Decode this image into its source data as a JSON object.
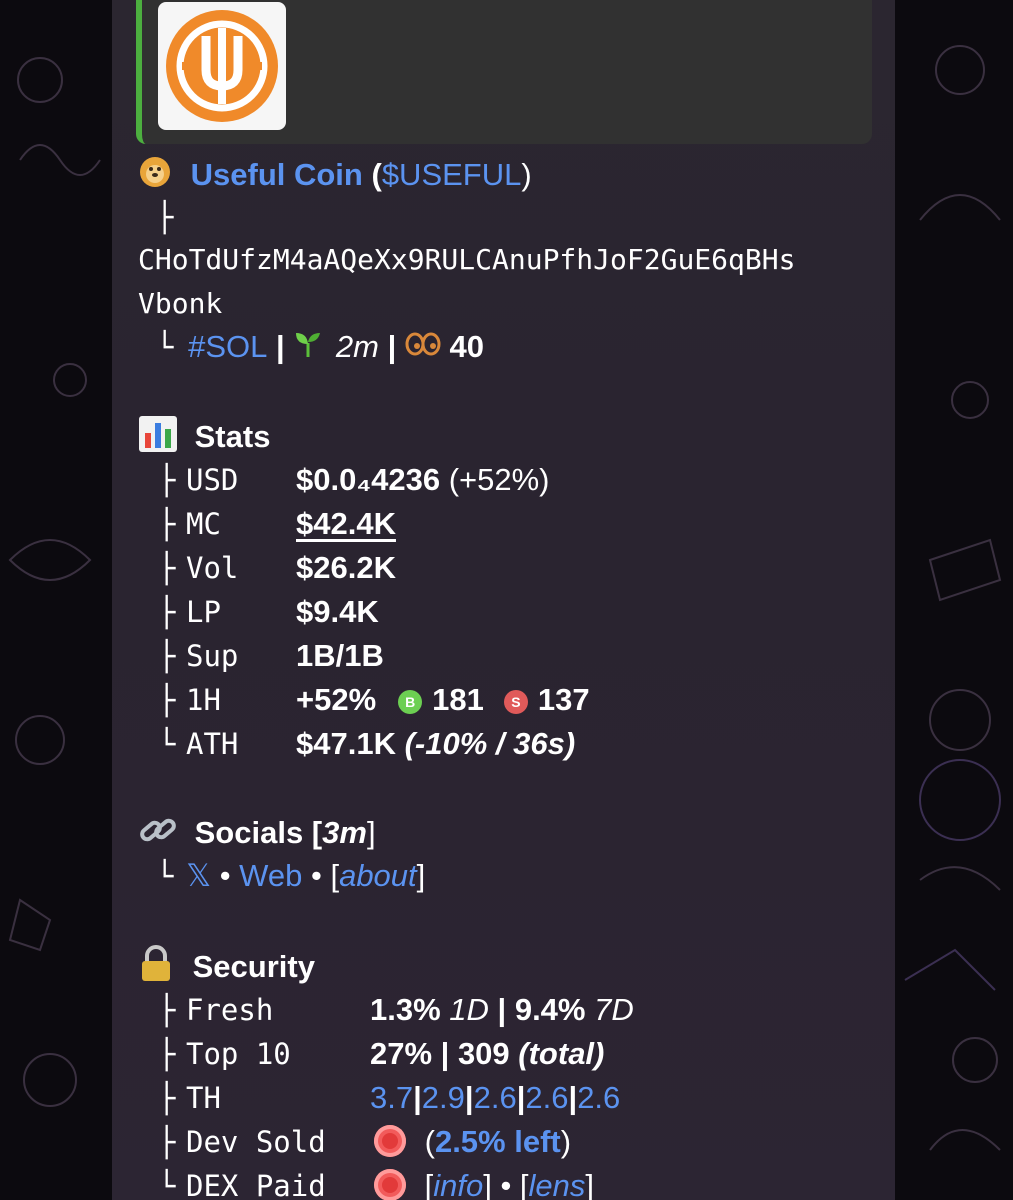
{
  "token": {
    "name": "Useful Coin",
    "ticker_open": "(",
    "ticker": "$USEFUL",
    "ticker_close": ")",
    "address_line1": "CHoTdUfzM4aAQeXx9RULCAnuPfhJoF2GuE6qBHs",
    "address_line2": "Vbonk",
    "chain": "#SOL",
    "age": "2m",
    "holders_count": "40"
  },
  "stats": {
    "heading": "Stats",
    "rows": [
      {
        "label": "USD",
        "value": "$0.0₄4236",
        "extra": " (+52%)"
      },
      {
        "label": "MC",
        "value": "$42.4K"
      },
      {
        "label": "Vol",
        "value": "$26.2K"
      },
      {
        "label": "LP",
        "value": "$9.4K"
      },
      {
        "label": "Sup",
        "value": "1B/1B"
      },
      {
        "label": "1H",
        "value": "+52%",
        "buys": "181",
        "sells": "137"
      },
      {
        "label": "ATH",
        "value": "$47.1K",
        "extra": " (-10% / 36s)"
      }
    ]
  },
  "socials": {
    "heading": "Socials [",
    "age": "3m",
    "heading_close": "]",
    "x": "𝕏",
    "sep": " • ",
    "web": "Web",
    "about_open": "[",
    "about": "about",
    "about_close": "]"
  },
  "security": {
    "heading": "Security",
    "fresh_label": "Fresh",
    "fresh_1d": "1.3%",
    "fresh_1d_unit": " 1D",
    "fresh_sep": " | ",
    "fresh_7d": "9.4%",
    "fresh_7d_unit": " 7D",
    "top10_label": "Top 10",
    "top10_value": "27% | 309",
    "top10_extra": " (total)",
    "th_label": "TH",
    "th_values": [
      "3.7",
      "2.9",
      "2.6",
      "2.6",
      "2.6"
    ],
    "dev_label": "Dev Sold",
    "dev_open": "(",
    "dev_value": "2.5% left",
    "dev_close": ")",
    "dex_label": "DEX Paid",
    "dex_open": "[",
    "dex_info": "info",
    "dex_mid": "] • [",
    "dex_lens": "lens",
    "dex_close": "]"
  },
  "glyphs": {
    "tee": "├",
    "corner": "└",
    "pipe": " | "
  },
  "colors": {
    "link": "#5b93f0",
    "preview_bar": "#4caf3f",
    "logo_orange": "#f08a2a",
    "buy_green": "#6ccf52",
    "sell_red": "#e05a5a"
  }
}
